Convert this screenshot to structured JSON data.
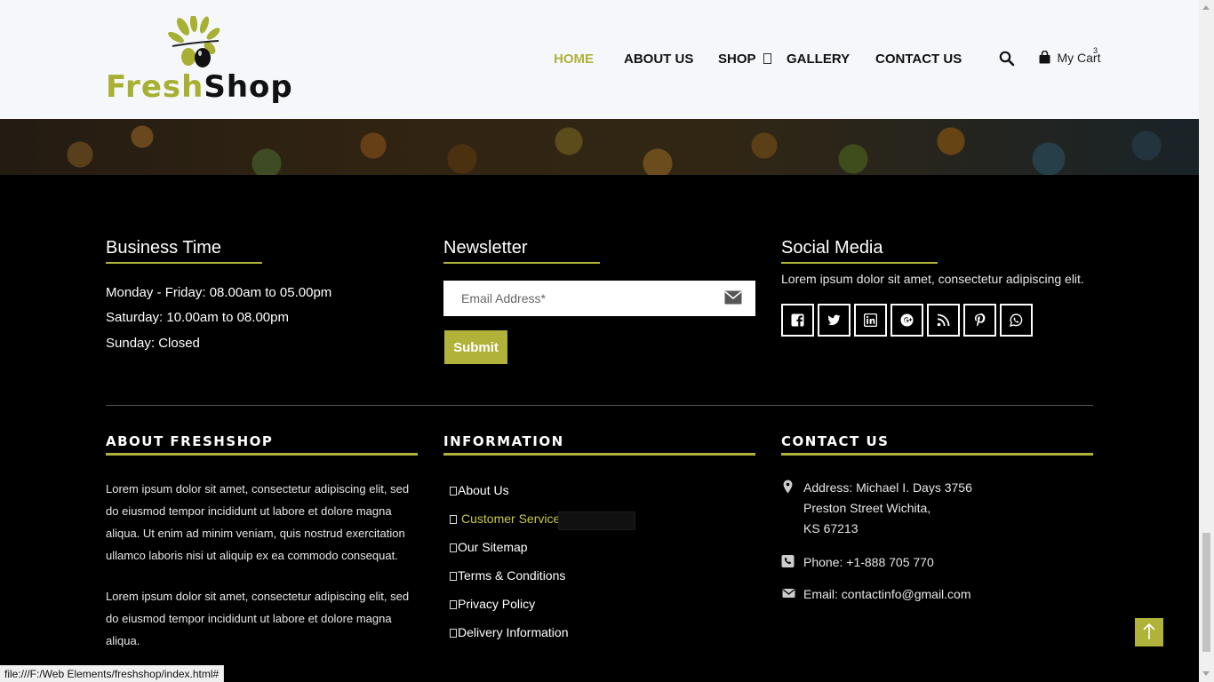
{
  "header": {
    "logo": {
      "word_fresh": "Fresh",
      "word_shop": "Shop"
    },
    "nav": [
      {
        "label": "HOME",
        "active": true
      },
      {
        "label": "ABOUT US",
        "active": false
      },
      {
        "label": "SHOP",
        "active": false,
        "dropdown": true
      },
      {
        "label": "GALLERY",
        "active": false
      },
      {
        "label": "CONTACT US",
        "active": false
      }
    ],
    "search_icon": "search-icon",
    "cart": {
      "label": "My Cart",
      "count": "3",
      "icon": "shopping-bag-icon"
    }
  },
  "footer_top": {
    "business_time": {
      "title": "Business Time",
      "lines": [
        "Monday - Friday: 08.00am to 05.00pm",
        "Saturday: 10.00am to 08.00pm",
        "Sunday: Closed"
      ]
    },
    "newsletter": {
      "title": "Newsletter",
      "email_placeholder": "Email Address*",
      "submit_label": "Submit"
    },
    "social_media": {
      "title": "Social Media",
      "text": "Lorem ipsum dolor sit amet, consectetur adipiscing elit.",
      "icons": [
        "facebook-icon",
        "twitter-icon",
        "linkedin-icon",
        "google-plus-icon",
        "rss-icon",
        "pinterest-icon",
        "whatsapp-icon"
      ]
    }
  },
  "footer_bottom": {
    "about": {
      "title": "ABOUT FRESHSHOP",
      "paragraphs": [
        "Lorem ipsum dolor sit amet, consectetur adipiscing elit, sed do eiusmod tempor incididunt ut labore et dolore magna aliqua. Ut enim ad minim veniam, quis nostrud exercitation ullamco laboris nisi ut aliquip ex ea commodo consequat.",
        "Lorem ipsum dolor sit amet, consectetur adipiscing elit, sed do eiusmod tempor incididunt ut labore et dolore magna aliqua."
      ]
    },
    "information": {
      "title": "INFORMATION",
      "links": [
        "About Us",
        "Customer Service",
        "Our Sitemap",
        "Terms & Conditions",
        "Privacy Policy",
        "Delivery Information"
      ]
    },
    "contact": {
      "title": "CONTACT US",
      "address_lines": [
        "Address: Michael I. Days 3756",
        "Preston Street Wichita,",
        "KS 67213"
      ],
      "phone": "Phone: +1-888 705 770",
      "email": "Email: contactinfo@gmail.com"
    }
  },
  "status_bar": {
    "url": "file:///F:/Web Elements/freshshop/index.html#"
  },
  "colors": {
    "accent": "#b0b23a",
    "background": "#000000",
    "header_bg": "#f5f7fa"
  }
}
